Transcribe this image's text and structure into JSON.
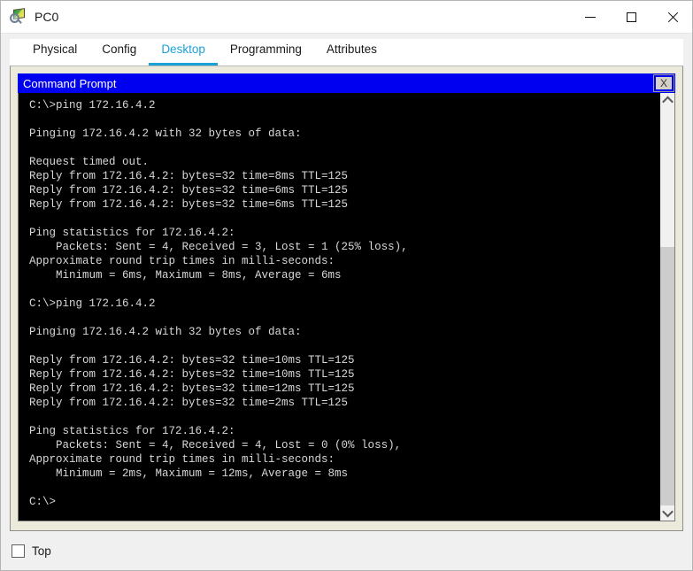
{
  "window": {
    "title": "PC0",
    "icon": "inspect-magnifier-icon",
    "controls": {
      "minimize_label": "—",
      "maximize_label": "□",
      "close_label": "✕"
    }
  },
  "tabs": [
    {
      "label": "Physical",
      "active": false
    },
    {
      "label": "Config",
      "active": false
    },
    {
      "label": "Desktop",
      "active": true
    },
    {
      "label": "Programming",
      "active": false
    },
    {
      "label": "Attributes",
      "active": false
    }
  ],
  "command_prompt": {
    "title": "Command Prompt",
    "close_button_label": "X",
    "accent_color": "#0000f0",
    "background_color": "#000000",
    "text_color": "#d8d8d8",
    "output": "C:\\>ping 172.16.4.2\n\nPinging 172.16.4.2 with 32 bytes of data:\n\nRequest timed out.\nReply from 172.16.4.2: bytes=32 time=8ms TTL=125\nReply from 172.16.4.2: bytes=32 time=6ms TTL=125\nReply from 172.16.4.2: bytes=32 time=6ms TTL=125\n\nPing statistics for 172.16.4.2:\n    Packets: Sent = 4, Received = 3, Lost = 1 (25% loss),\nApproximate round trip times in milli-seconds:\n    Minimum = 6ms, Maximum = 8ms, Average = 6ms\n\nC:\\>ping 172.16.4.2\n\nPinging 172.16.4.2 with 32 bytes of data:\n\nReply from 172.16.4.2: bytes=32 time=10ms TTL=125\nReply from 172.16.4.2: bytes=32 time=10ms TTL=125\nReply from 172.16.4.2: bytes=32 time=12ms TTL=125\nReply from 172.16.4.2: bytes=32 time=2ms TTL=125\n\nPing statistics for 172.16.4.2:\n    Packets: Sent = 4, Received = 4, Lost = 0 (0% loss),\nApproximate round trip times in milli-seconds:\n    Minimum = 2ms, Maximum = 12ms, Average = 8ms\n\nC:\\>",
    "scrollbar": {
      "up_arrow": "chevron-up-icon",
      "down_arrow": "chevron-down-icon",
      "thumb_top_percent": 35
    }
  },
  "bottom": {
    "top_checkbox_label": "Top",
    "top_checkbox_checked": false
  }
}
